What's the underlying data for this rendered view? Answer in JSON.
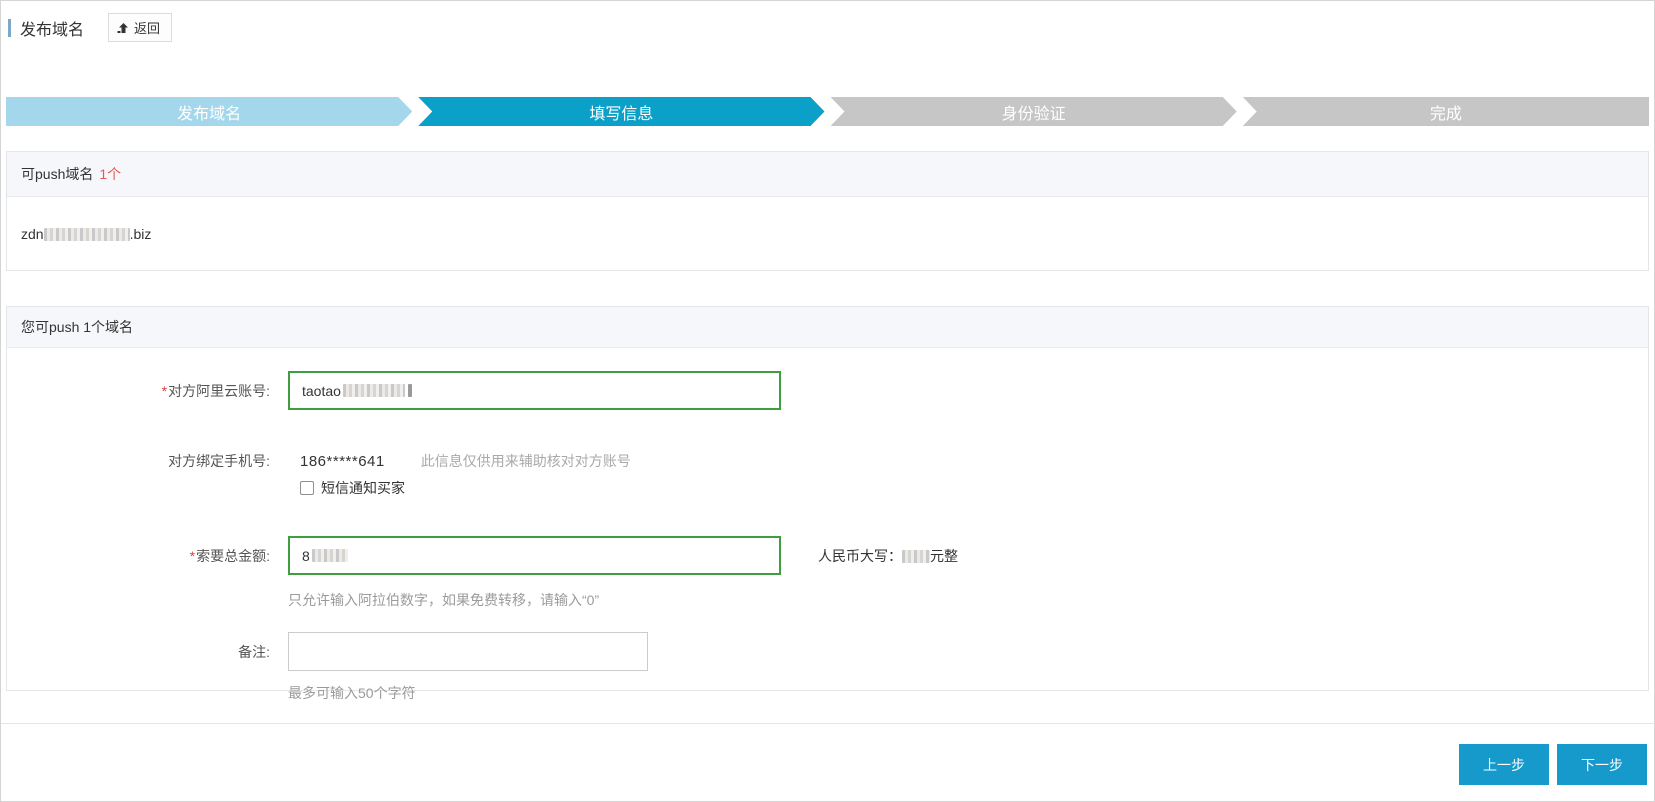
{
  "page": {
    "title": "发布域名",
    "back_label": "返回"
  },
  "steps": [
    {
      "label": "发布域名",
      "state": "done"
    },
    {
      "label": "填写信息",
      "state": "active"
    },
    {
      "label": "身份验证",
      "state": "todo"
    },
    {
      "label": "完成",
      "state": "todo"
    }
  ],
  "available_section": {
    "title": "可push域名",
    "count": "1个",
    "domain": {
      "prefix": "zdn",
      "suffix": ".biz",
      "middle_redacted": true
    }
  },
  "form_section": {
    "title": "您可push 1个域名",
    "fields": {
      "account": {
        "required_mark": "*",
        "label": "对方阿里云账号:",
        "value_prefix": "taotao",
        "value_redacted": true
      },
      "phone": {
        "label": "对方绑定手机号:",
        "value": "186*****641",
        "hint": "此信息仅供用来辅助核对对方账号",
        "sms_checkbox_label": "短信通知买家",
        "sms_checked": false
      },
      "amount": {
        "required_mark": "*",
        "label": "索要总金额:",
        "value_prefix": "8",
        "value_redacted": true,
        "rmb_label": "人民币大写：",
        "rmb_suffix": "元整",
        "hint": "只允许输入阿拉伯数字，如果免费转移，请输入“0”"
      },
      "remark": {
        "label": "备注:",
        "value": "",
        "hint": "最多可输入50个字符"
      }
    }
  },
  "footer": {
    "prev_label": "上一步",
    "next_label": "下一步"
  },
  "colors": {
    "step_done": "#a4d7ec",
    "step_active": "#0ba0c8",
    "step_todo": "#c6c6c6",
    "primary_button": "#1699cb",
    "required_mark": "#e4393c",
    "count_red": "#e25a50",
    "valid_input_border": "#3f9e3f",
    "title_marker": "#7ea9c6"
  }
}
